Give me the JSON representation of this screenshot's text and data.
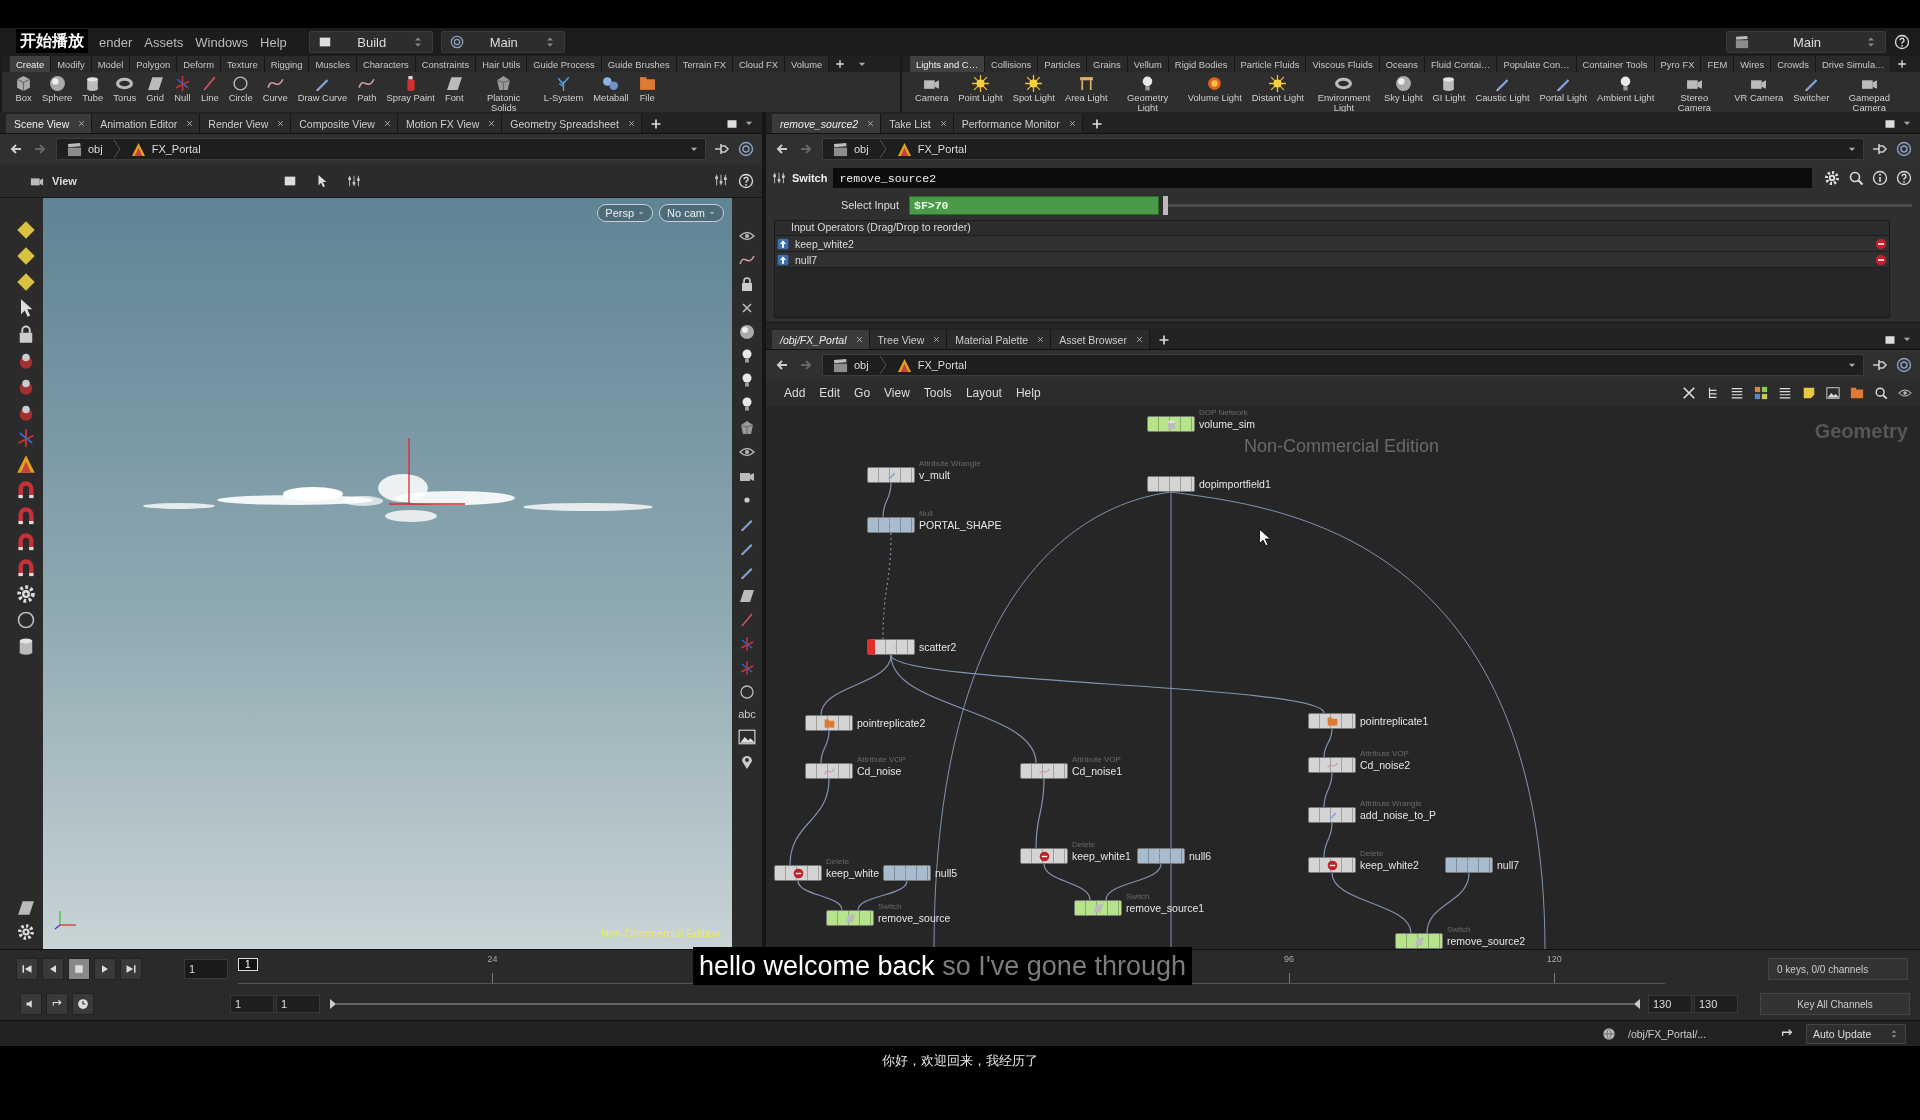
{
  "overlay_label": "开始播放",
  "menu": [
    "ender",
    "Assets",
    "Windows",
    "Help"
  ],
  "desktop_menu": "Build",
  "layout_menu": "Main",
  "right_menu": "Main",
  "shelf_left": {
    "tabs": [
      {
        "label": "Create",
        "selected": true
      },
      {
        "label": "Modify",
        "selected": false
      },
      {
        "label": "Model",
        "selected": false
      },
      {
        "label": "Polygon",
        "selected": false
      },
      {
        "label": "Deform",
        "selected": false
      },
      {
        "label": "Texture",
        "selected": false
      },
      {
        "label": "Rigging",
        "selected": false
      },
      {
        "label": "Muscles",
        "selected": false
      },
      {
        "label": "Characters",
        "selected": false
      },
      {
        "label": "Constraints",
        "selected": false
      },
      {
        "label": "Hair Utils",
        "selected": false
      },
      {
        "label": "Guide Process",
        "selected": false
      },
      {
        "label": "Guide Brushes",
        "selected": false
      },
      {
        "label": "Terrain FX",
        "selected": false
      },
      {
        "label": "Cloud FX",
        "selected": false
      },
      {
        "label": "Volume",
        "selected": false
      }
    ],
    "tools": [
      "Box",
      "Sphere",
      "Tube",
      "Torus",
      "Grid",
      "Null",
      "Line",
      "Circle",
      "Curve",
      "Draw Curve",
      "Path",
      "Spray Paint",
      "Font",
      "Platonic Solids",
      "L-System",
      "Metaball",
      "File"
    ]
  },
  "shelf_right": {
    "tabs": [
      {
        "label": "Lights and C…",
        "selected": true
      },
      {
        "label": "Collisions",
        "selected": false
      },
      {
        "label": "Particles",
        "selected": false
      },
      {
        "label": "Grains",
        "selected": false
      },
      {
        "label": "Vellum",
        "selected": false
      },
      {
        "label": "Rigid Bodies",
        "selected": false
      },
      {
        "label": "Particle Fluids",
        "selected": false
      },
      {
        "label": "Viscous Fluids",
        "selected": false
      },
      {
        "label": "Oceans",
        "selected": false
      },
      {
        "label": "Fluid Contai…",
        "selected": false
      },
      {
        "label": "Populate Con…",
        "selected": false
      },
      {
        "label": "Container Tools",
        "selected": false
      },
      {
        "label": "Pyro FX",
        "selected": false
      },
      {
        "label": "FEM",
        "selected": false
      },
      {
        "label": "Wires",
        "selected": false
      },
      {
        "label": "Crowds",
        "selected": false
      },
      {
        "label": "Drive Simula…",
        "selected": false
      }
    ],
    "tools": [
      "Camera",
      "Point Light",
      "Spot Light",
      "Area Light",
      "Geometry Light",
      "Volume Light",
      "Distant Light",
      "Environment Light",
      "Sky Light",
      "GI Light",
      "Caustic Light",
      "Portal Light",
      "Ambient Light",
      "Stereo Camera",
      "VR Camera",
      "Switcher",
      "Gamepad Camera"
    ]
  },
  "scene_pane": {
    "tabs": [
      {
        "label": "Scene View",
        "selected": true
      },
      {
        "label": "Animation Editor",
        "selected": false
      },
      {
        "label": "Render View",
        "selected": false
      },
      {
        "label": "Composite View",
        "selected": false
      },
      {
        "label": "Motion FX View",
        "selected": false
      },
      {
        "label": "Geometry Spreadsheet",
        "selected": false
      }
    ],
    "path": [
      "obj",
      "FX_Portal"
    ],
    "view_label": "View",
    "camera_menus": [
      "Persp",
      "No cam"
    ],
    "watermark": "Non-Commercial Edition",
    "toolbar_text": "abc"
  },
  "param_pane": {
    "tabs": [
      {
        "label": "remove_source2",
        "selected": true
      },
      {
        "label": "Take List",
        "selected": false
      },
      {
        "label": "Performance Monitor",
        "selected": false
      }
    ],
    "path": [
      "obj",
      "FX_Portal"
    ],
    "node_type": "Switch",
    "node_name": "remove_source2",
    "select_input": {
      "label": "Select Input",
      "value": "$F>70",
      "level": 0
    },
    "list_header": "Input Operators (Drag/Drop to reorder)",
    "inputs": [
      "keep_white2",
      "null7"
    ]
  },
  "network_pane": {
    "tabs": [
      {
        "label": "/obj/FX_Portal",
        "selected": true
      },
      {
        "label": "Tree View",
        "selected": false
      },
      {
        "label": "Material Palette",
        "selected": false
      },
      {
        "label": "Asset Browser",
        "selected": false
      }
    ],
    "path": [
      "obj",
      "FX_Portal"
    ],
    "menu": [
      "Add",
      "Edit",
      "Go",
      "View",
      "Tools",
      "Layout",
      "Help"
    ],
    "watermark": "Non-Commercial Edition",
    "context_label": "Geometry",
    "nodes": [
      {
        "type": "DOP Network",
        "name": "volume_sim",
        "kind": "dop"
      },
      {
        "type": "Attribute Wrangle",
        "name": "v_mult",
        "kind": "wrangle"
      },
      {
        "type": "Null",
        "name": "PORTAL_SHAPE",
        "kind": "null"
      },
      {
        "name": "dopimportfield1",
        "kind": "dopimport"
      },
      {
        "name": "scatter2",
        "kind": "scatter"
      },
      {
        "name": "pointreplicate2",
        "kind": "replicate"
      },
      {
        "type": "Attribute VOP",
        "name": "Cd_noise",
        "kind": "vop"
      },
      {
        "type": "Attribute VOP",
        "name": "Cd_noise1",
        "kind": "vop"
      },
      {
        "name": "pointreplicate1",
        "kind": "replicate"
      },
      {
        "type": "Attribute VOP",
        "name": "Cd_noise2",
        "kind": "vop"
      },
      {
        "type": "Attribute Wrangle",
        "name": "add_noise_to_P",
        "kind": "wrangle"
      },
      {
        "type": "Delete",
        "name": "keep_white",
        "kind": "delete"
      },
      {
        "name": "null5",
        "kind": "null"
      },
      {
        "type": "Delete",
        "name": "keep_white1",
        "kind": "delete"
      },
      {
        "name": "null6",
        "kind": "null"
      },
      {
        "type": "Delete",
        "name": "keep_white2",
        "kind": "delete"
      },
      {
        "name": "null7",
        "kind": "null"
      },
      {
        "type": "Switch",
        "name": "remove_source",
        "kind": "switch"
      },
      {
        "type": "Switch",
        "name": "remove_source1",
        "kind": "switch"
      },
      {
        "type": "Switch",
        "name": "remove_source2",
        "kind": "switch"
      }
    ]
  },
  "timeline": {
    "current_frame": "1",
    "marker": "1",
    "ticks": [
      "24",
      "96",
      "120"
    ],
    "range_start": "1",
    "range_start2": "1",
    "range_end": "130",
    "range_end2": "130",
    "keys_info": "0 keys, 0/0 channels",
    "key_button": "Key All Channels"
  },
  "status_bar": {
    "path": "/obj/FX_Portal/...",
    "update_mode": "Auto Update"
  },
  "captions": {
    "spoken": "hello welcome back",
    "upcoming": "so I've gone through",
    "translation": "你好，欢迎回来，我经历了"
  }
}
